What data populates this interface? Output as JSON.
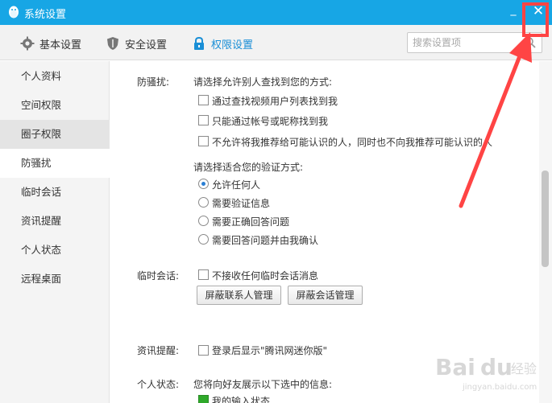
{
  "window": {
    "title": "系统设置",
    "minimize": "_",
    "close": "✕"
  },
  "tabs": [
    {
      "label": "基本设置",
      "icon": "gear-icon"
    },
    {
      "label": "安全设置",
      "icon": "shield-icon"
    },
    {
      "label": "权限设置",
      "icon": "lock-icon",
      "active": true
    }
  ],
  "search": {
    "placeholder": "搜索设置项"
  },
  "sidebar": {
    "items": [
      {
        "label": "个人资料"
      },
      {
        "label": "空间权限"
      },
      {
        "label": "圈子权限"
      },
      {
        "label": "防骚扰"
      },
      {
        "label": "临时会话"
      },
      {
        "label": "资讯提醒"
      },
      {
        "label": "个人状态"
      },
      {
        "label": "远程桌面"
      }
    ]
  },
  "main": {
    "antiharass": {
      "label": "防骚扰:",
      "find_prompt": "请选择允许别人查找到您的方式:",
      "find_options": [
        {
          "label": "通过查找视频用户列表找到我",
          "checked": false
        },
        {
          "label": "只能通过帐号或昵称找到我",
          "checked": false
        },
        {
          "label": "不允许将我推荐给可能认识的人，同时也不向我推荐可能认识的人",
          "checked": false
        }
      ],
      "verify_prompt": "请选择适合您的验证方式:",
      "verify_options": [
        {
          "label": "允许任何人",
          "selected": true
        },
        {
          "label": "需要验证信息",
          "selected": false
        },
        {
          "label": "需要正确回答问题",
          "selected": false
        },
        {
          "label": "需要回答问题并由我确认",
          "selected": false
        }
      ]
    },
    "tempchat": {
      "label": "临时会话:",
      "option": "不接收任何临时会话消息",
      "btn_contacts": "屏蔽联系人管理",
      "btn_sessions": "屏蔽会话管理"
    },
    "news": {
      "label": "资讯提醒:",
      "option": "登录后显示\"腾讯网迷你版\""
    },
    "status": {
      "label": "个人状态:",
      "prompt": "您将向好友展示以下选中的信息:",
      "option": "我的输入状态"
    }
  },
  "watermark": {
    "text": "Baidu经验",
    "sub": "jingyan.baidu.com"
  },
  "colors": {
    "titlebar": "#17a6e5",
    "accent": "#1a8fd6",
    "annotation": "#ff4444"
  }
}
